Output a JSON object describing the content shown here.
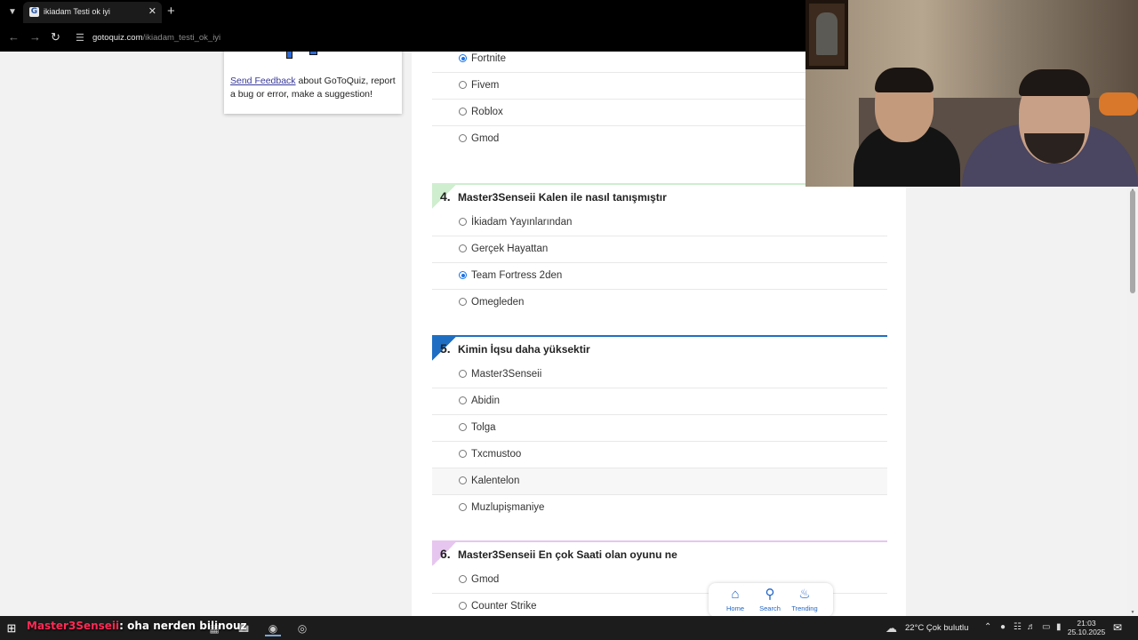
{
  "browser": {
    "tab_title": "ikiadam Testi ok iyi",
    "tab_favicon": "G",
    "url_host": "gotoquiz.com",
    "url_path": "/ikiadam_testi_ok_iyi"
  },
  "sidebar": {
    "feedback_link": "Send Feedback",
    "feedback_rest": " about GoToQuiz, report a bug or error, make a suggestion!"
  },
  "quiz": {
    "prev_options": [
      {
        "label": "Fortnite",
        "checked": true
      },
      {
        "label": "Fivem",
        "checked": false
      },
      {
        "label": "Roblox",
        "checked": false
      },
      {
        "label": "Gmod",
        "checked": false
      }
    ],
    "questions": [
      {
        "number": "4.",
        "text": "Master3Senseii Kalen ile nasıl tanışmıştır",
        "accent": "#cfeecf",
        "options": [
          {
            "label": "İkiadam Yayınlarından",
            "checked": false
          },
          {
            "label": "Gerçek Hayattan",
            "checked": false
          },
          {
            "label": "Team Fortress 2den",
            "checked": true
          },
          {
            "label": "Omegleden",
            "checked": false
          }
        ]
      },
      {
        "number": "5.",
        "text": "Kimin İqsu daha yüksektir",
        "accent": "#1e6fc4",
        "options": [
          {
            "label": "Master3Senseii",
            "checked": false
          },
          {
            "label": "Abidin",
            "checked": false
          },
          {
            "label": "Tolga",
            "checked": false
          },
          {
            "label": "Txcmustoo",
            "checked": false
          },
          {
            "label": "Kalentelon",
            "checked": false
          },
          {
            "label": "Muzlupişmaniye",
            "checked": false
          }
        ]
      },
      {
        "number": "6.",
        "text": "Master3Senseii En çok Saati olan oyunu ne",
        "accent": "#e6c6ef",
        "options": [
          {
            "label": "Gmod",
            "checked": false
          },
          {
            "label": "Counter Strike",
            "checked": false
          }
        ]
      }
    ]
  },
  "bottom_nav": {
    "home": "Home",
    "search": "Search",
    "trending": "Trending"
  },
  "taskbar": {
    "chat_name": "Master3Senseii",
    "chat_message": ": oha nerden bilinouz",
    "weather": "22°C  Çok bulutlu",
    "time": "21:03",
    "date": "25.10.2025"
  }
}
